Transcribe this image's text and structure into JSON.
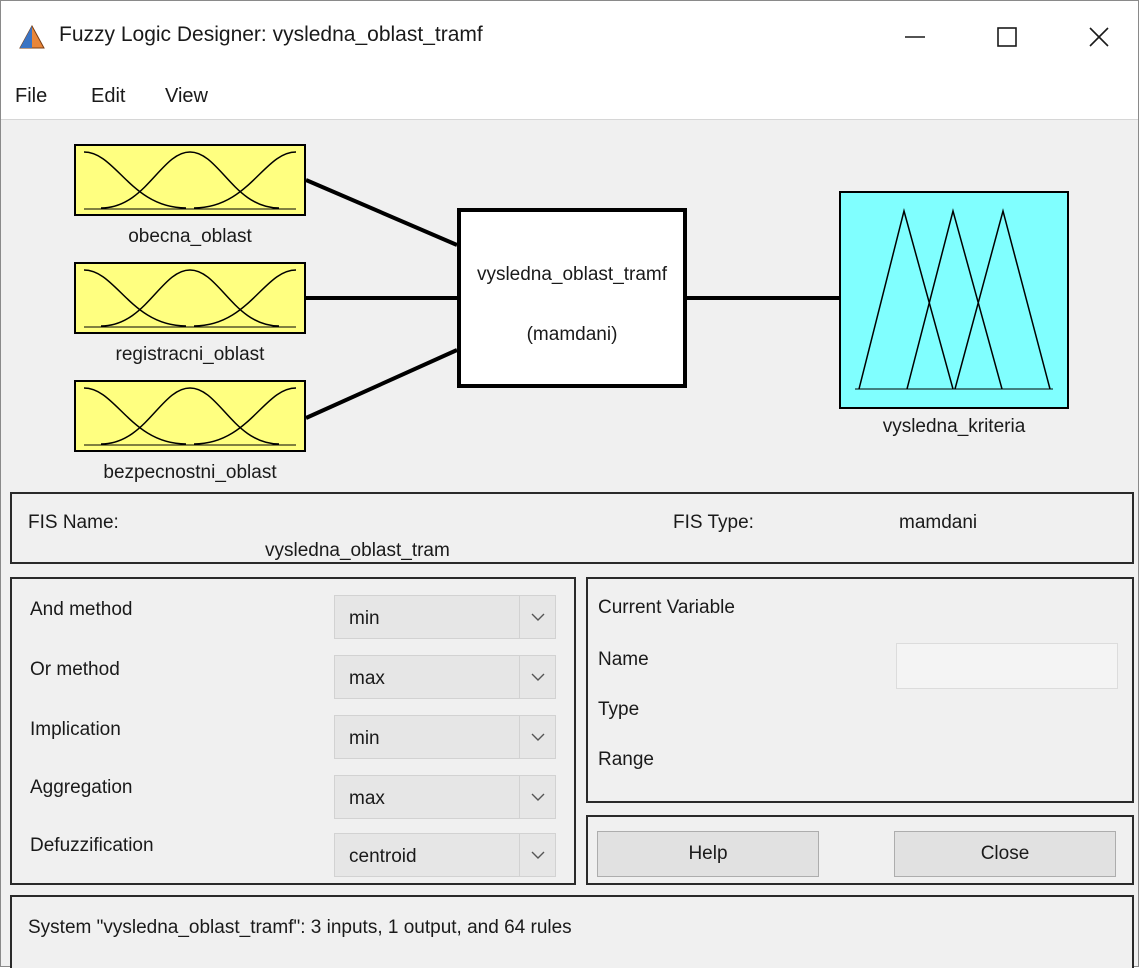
{
  "window": {
    "title": "Fuzzy Logic Designer: vysledna_oblast_tramf",
    "min_glyph": "—",
    "max_glyph": "☐",
    "close_glyph": "✕",
    "app_icon": "matlab-icon"
  },
  "menu": [
    "File",
    "Edit",
    "View"
  ],
  "diagram": {
    "inputs": [
      "obecna_oblast",
      "registracni_oblast",
      "bezpecnostni_oblast"
    ],
    "input_color": "#ffff80",
    "system_name": "vysledna_oblast_tramf",
    "system_type": "(mamdani)",
    "output": "vysledna_kriteria",
    "output_color": "#80ffff"
  },
  "fis": {
    "name_label": "FIS Name:",
    "name_value": "vysledna_oblast_tram",
    "type_label": "FIS Type:",
    "type_value": "mamdani"
  },
  "methods": [
    {
      "label": "And method",
      "value": "min"
    },
    {
      "label": "Or method",
      "value": "max"
    },
    {
      "label": "Implication",
      "value": "min"
    },
    {
      "label": "Aggregation",
      "value": "max"
    },
    {
      "label": "Defuzzification",
      "value": "centroid"
    }
  ],
  "current_variable": {
    "title": "Current Variable",
    "name_label": "Name",
    "name_value": "",
    "type_label": "Type",
    "range_label": "Range"
  },
  "buttons": {
    "help": "Help",
    "close": "Close"
  },
  "status": "System \"vysledna_oblast_tramf\": 3 inputs, 1 output, and 64 rules"
}
